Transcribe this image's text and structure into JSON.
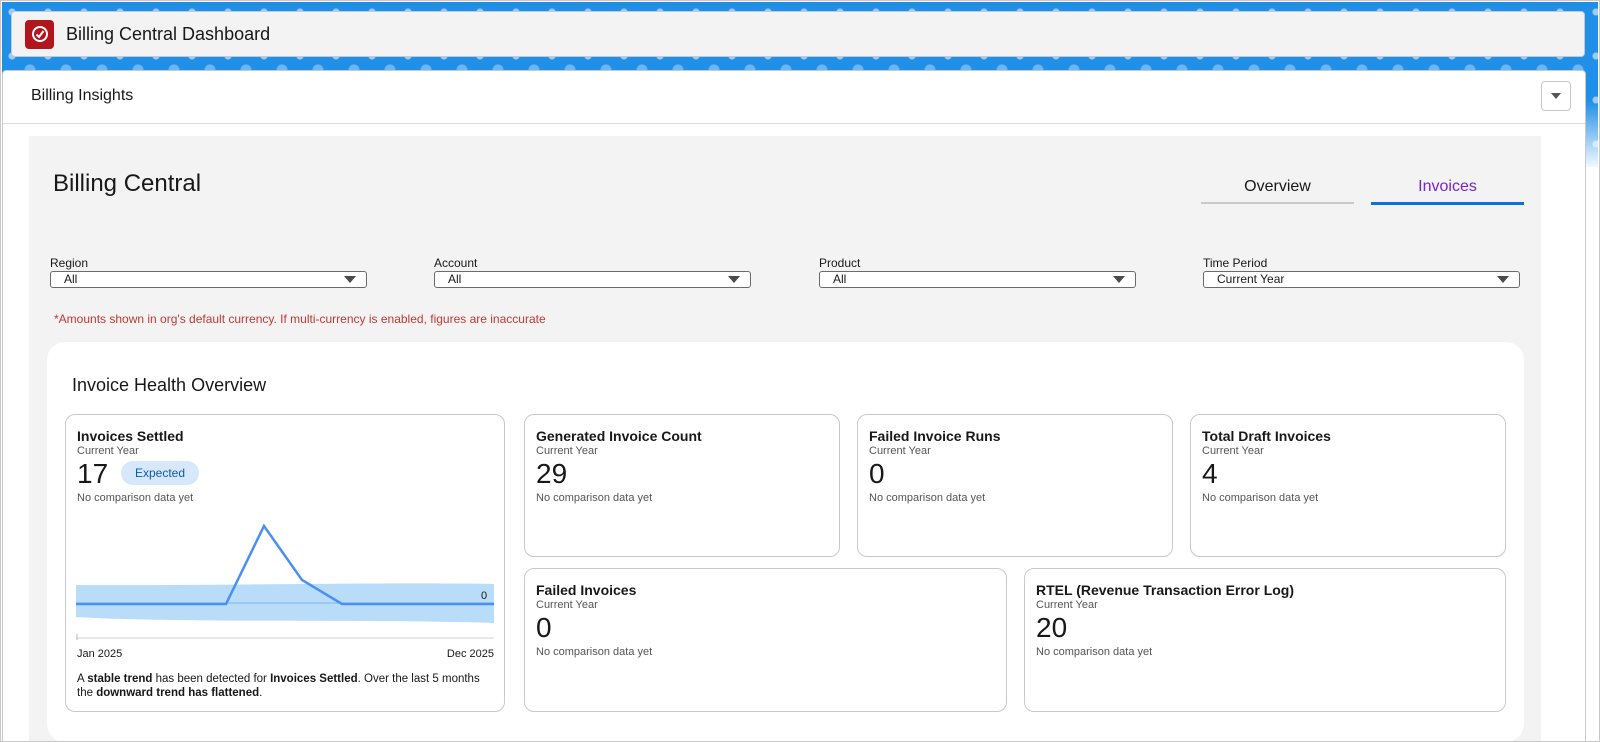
{
  "app": {
    "title": "Billing Central Dashboard"
  },
  "card": {
    "title": "Billing Insights"
  },
  "page": {
    "title": "Billing Central"
  },
  "tabs": [
    {
      "label": "Overview",
      "active": false
    },
    {
      "label": "Invoices",
      "active": true
    }
  ],
  "filters": [
    {
      "label": "Region",
      "value": "All"
    },
    {
      "label": "Account",
      "value": "All"
    },
    {
      "label": "Product",
      "value": "All"
    },
    {
      "label": "Time Period",
      "value": "Current Year"
    }
  ],
  "currency_note": "*Amounts shown in org's default currency. If multi-currency is enabled, figures are inaccurate",
  "health": {
    "title": "Invoice Health Overview",
    "settled": {
      "title": "Invoices Settled",
      "period": "Current Year",
      "value": "17",
      "badge": "Expected",
      "note": "No comparison data yet",
      "chart_start": "Jan 2025",
      "chart_end": "Dec 2025",
      "chart_end_value": "0",
      "trend": {
        "p1": "A ",
        "b1": "stable trend",
        "p2": " has been detected for ",
        "b2": "Invoices Settled",
        "p3": ". Over the last 5 months the ",
        "b3": "downward trend has flattened",
        "p4": "."
      }
    },
    "generated": {
      "title": "Generated Invoice Count",
      "period": "Current Year",
      "value": "29",
      "note": "No comparison data yet"
    },
    "failed_runs": {
      "title": "Failed Invoice Runs",
      "period": "Current Year",
      "value": "0",
      "note": "No comparison data yet"
    },
    "drafts": {
      "title": "Total Draft Invoices",
      "period": "Current Year",
      "value": "4",
      "note": "No comparison data yet"
    },
    "failed_invoices": {
      "title": "Failed Invoices",
      "period": "Current Year",
      "value": "0",
      "note": "No comparison data yet"
    },
    "rtel": {
      "title": "RTEL (Revenue Transaction Error Log)",
      "period": "Current Year",
      "value": "20",
      "note": "No comparison data yet"
    }
  },
  "colors": {
    "accent": "#0b73d6",
    "active_tab": "#7526c5",
    "warning_text": "#c23934",
    "line": "#4a90f0",
    "band": "#b9dcf8",
    "logo": "#b3151d"
  }
}
